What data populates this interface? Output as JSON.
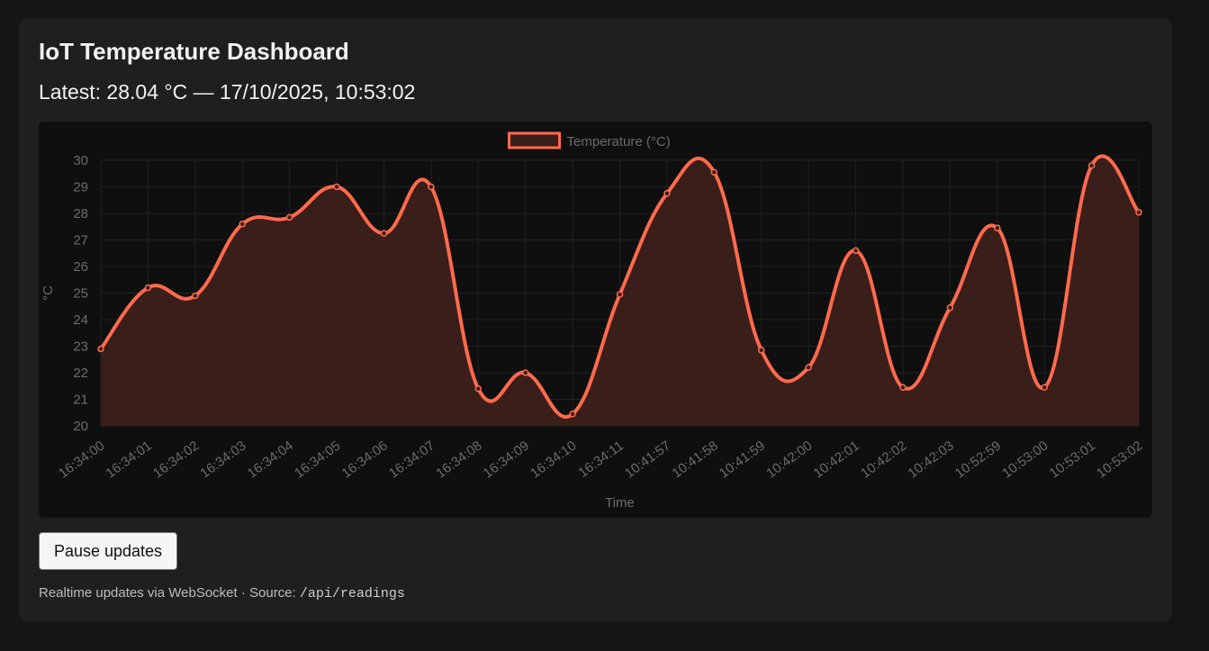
{
  "header": {
    "title": "IoT Temperature Dashboard",
    "latest": "Latest: 28.04 °C — 17/10/2025, 10:53:02"
  },
  "controls": {
    "pause_label": "Pause updates"
  },
  "footer": {
    "text": "Realtime updates via WebSocket · Source: ",
    "source": "/api/readings"
  },
  "colors": {
    "line": "#ff6a4d",
    "fill": "#3a1e1a",
    "grid": "#222222"
  },
  "chart_data": {
    "type": "area",
    "xlabel": "Time",
    "ylabel": "°C",
    "ylim": [
      20,
      30
    ],
    "yticks": [
      20,
      21,
      22,
      23,
      24,
      25,
      26,
      27,
      28,
      29,
      30
    ],
    "grid": true,
    "legend": "top-center",
    "categories": [
      "16:34:00",
      "16:34:01",
      "16:34:02",
      "16:34:03",
      "16:34:04",
      "16:34:05",
      "16:34:06",
      "16:34:07",
      "16:34:08",
      "16:34:09",
      "16:34:10",
      "16:34:11",
      "10:41:57",
      "10:41:58",
      "10:41:59",
      "10:42:00",
      "10:42:01",
      "10:42:02",
      "10:42:03",
      "10:52:59",
      "10:53:00",
      "10:53:01",
      "10:53:02"
    ],
    "series": [
      {
        "name": "Temperature (°C)",
        "values": [
          22.9,
          25.2,
          24.9,
          27.6,
          27.85,
          29.0,
          27.25,
          29.0,
          21.4,
          22.0,
          20.45,
          24.95,
          28.75,
          29.55,
          22.85,
          22.2,
          26.6,
          21.45,
          24.45,
          27.45,
          21.45,
          29.8,
          28.04
        ]
      }
    ]
  }
}
